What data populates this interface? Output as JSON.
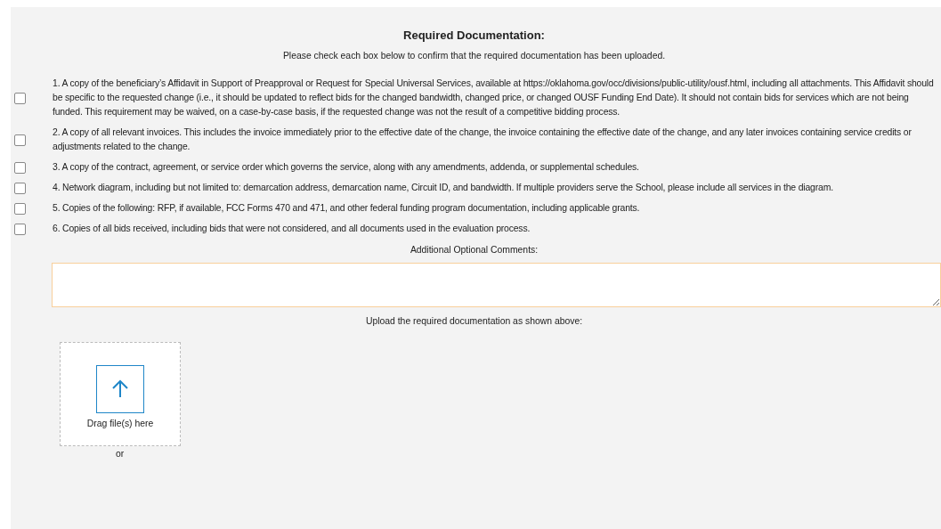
{
  "section": {
    "title": "Required Documentation:",
    "instruction": "Please check each box below to confirm that the required documentation has been uploaded."
  },
  "requirements": [
    {
      "text": "1. A copy of the beneficiary’s Affidavit in Support of Preapproval or Request for Special Universal Services, available at https://oklahoma.gov/occ/divisions/public-utility/ousf.html, including all attachments. This Affidavit should be specific to the requested change (i.e., it should be updated to reflect bids for the changed bandwidth, changed price, or changed OUSF Funding End Date). It should not contain bids for services which are not being funded. This requirement may be waived, on a case-by-case basis, if the requested change was not the result of a competitive bidding process.",
      "checked": false
    },
    {
      "text": "2. A copy of all relevant invoices. This includes the invoice immediately prior to the effective date of the change, the invoice containing the effective date of the change, and any later invoices containing service credits or adjustments related to the change.",
      "checked": false
    },
    {
      "text": "3. A copy of the contract, agreement, or service order which governs the service, along with any amendments, addenda, or supplemental schedules.",
      "checked": false
    },
    {
      "text": "4. Network diagram, including but not limited to: demarcation address, demarcation name, Circuit ID, and bandwidth. If multiple providers serve the School, please include all services in the diagram.",
      "checked": false
    },
    {
      "text": "5. Copies of the following: RFP, if available, FCC Forms 470 and 471, and other federal funding program documentation, including applicable grants.",
      "checked": false
    },
    {
      "text": "6. Copies of all bids received, including bids that were not considered, and all documents used in the evaluation process.",
      "checked": false
    }
  ],
  "comments": {
    "label": "Additional Optional Comments:"
  },
  "upload": {
    "label": "Upload the required documentation as shown above:",
    "drop_text": "Drag file(s) here",
    "or_text": "or"
  }
}
